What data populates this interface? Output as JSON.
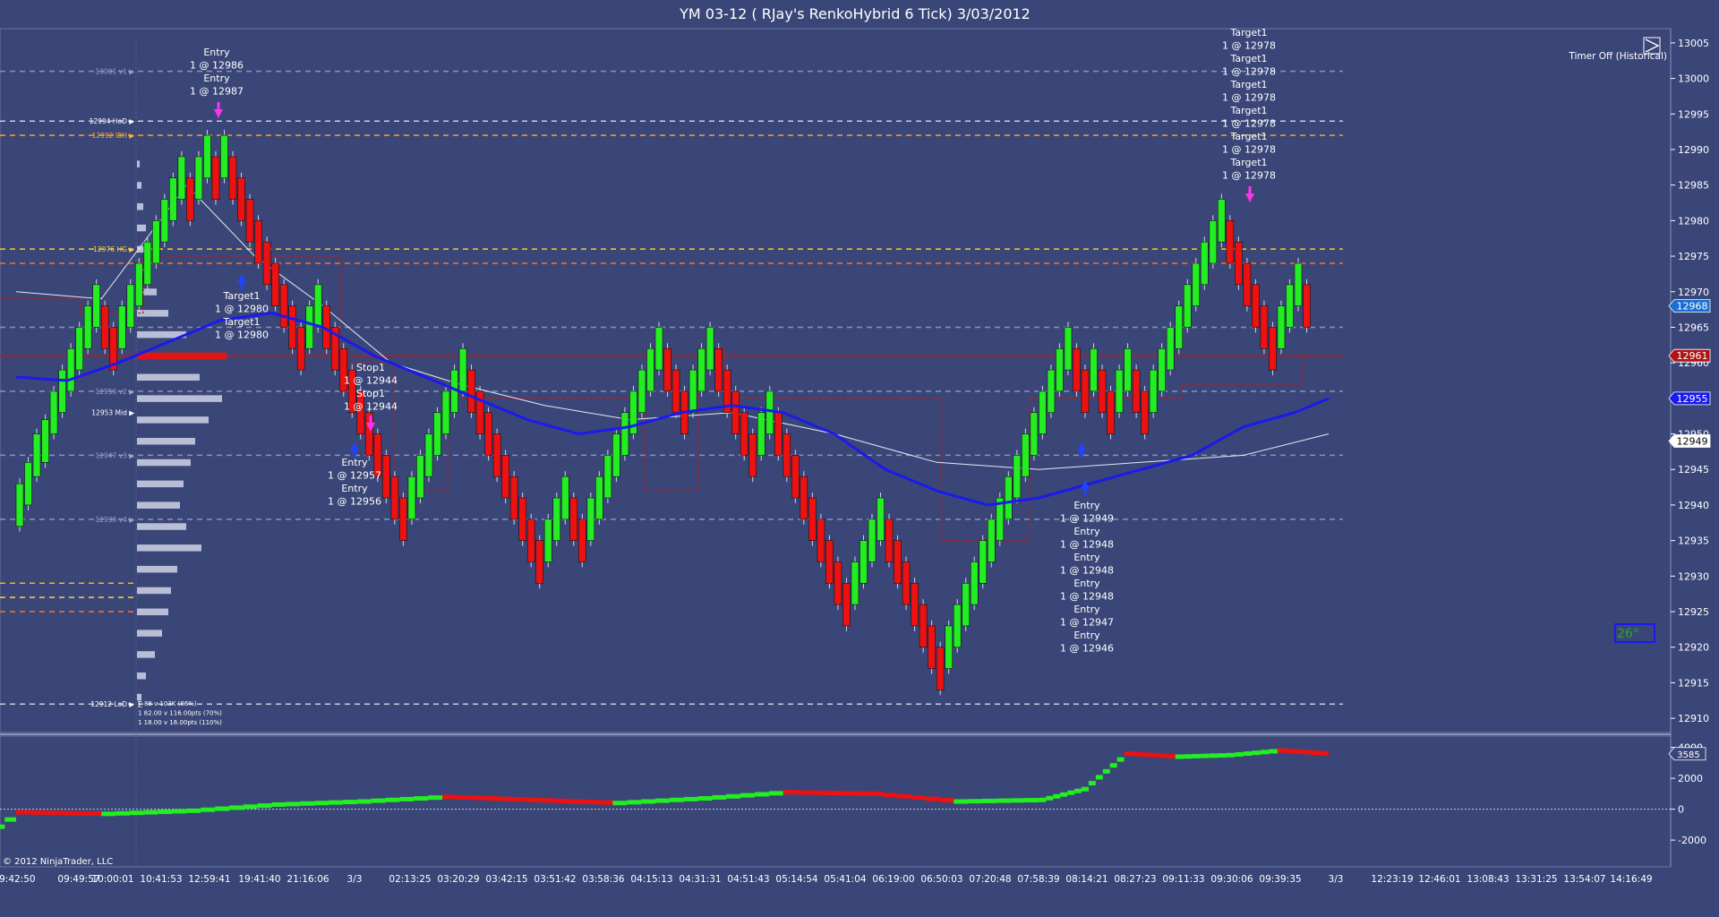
{
  "window": {
    "title": "YM 03-12 ( RJay's RenkoHybrid  6 Tick)  3/03/2012",
    "timer_label": "Timer Off (Historical)",
    "copyright": "© 2012 NinjaTrader, LLC",
    "temp_badge": "26°"
  },
  "colors": {
    "background": "#3a4677",
    "up_brick": "#22ee22",
    "down_brick": "#ee1111",
    "ma_line": "#1a1aee",
    "marker_entry": "#ff33ee",
    "marker_exit": "#2244ff"
  },
  "price_axis": {
    "min": 12908,
    "max": 13007,
    "ticks": [
      "13005",
      "13000",
      "12995",
      "12990",
      "12985",
      "12980",
      "12975",
      "12970",
      "12965",
      "12960",
      "12955",
      "12950",
      "12945",
      "12940",
      "12935",
      "12930",
      "12925",
      "12920",
      "12915",
      "12910"
    ],
    "badges": [
      {
        "label": "12968",
        "value": 12968,
        "bg": "#1a6fd0",
        "fg": "#ffffff"
      },
      {
        "label": "12961",
        "value": 12961,
        "bg": "#b01414",
        "fg": "#ffffff"
      },
      {
        "label": "12955",
        "value": 12955,
        "bg": "#1a1aee",
        "fg": "#ffffff"
      },
      {
        "label": "12949",
        "value": 12949,
        "bg": "#ffffff",
        "fg": "#000000"
      }
    ]
  },
  "level_labels": [
    {
      "label": "13001 v1 ▶",
      "value": 13001,
      "color": "#9aa3c8"
    },
    {
      "label": "12994 HoD ▶",
      "value": 12994,
      "color": "#ffffff"
    },
    {
      "label": "12992 IBH ▶",
      "value": 12992,
      "color": "#ffb020"
    },
    {
      "label": "12976 HG ▶",
      "value": 12976,
      "color": "#ffd040"
    },
    {
      "label": "12956 v2 ▶",
      "value": 12956,
      "color": "#9aa3c8"
    },
    {
      "label": "12953 Mid ▶",
      "value": 12953,
      "color": "#ffffff"
    },
    {
      "label": "12947 v3 ▶",
      "value": 12947,
      "color": "#9aa3c8"
    },
    {
      "label": "12938 v4 ▶",
      "value": 12938,
      "color": "#9aa3c8"
    },
    {
      "label": "12912 LoD ▶",
      "value": 12912,
      "color": "#ffffff"
    }
  ],
  "profile_stats": [
    "∑ 88 v 103K (86%)",
    "1 82.00 v 116.00pts (70%)",
    "1 18.00 v 16.00pts (110%)"
  ],
  "time_axis": {
    "labels": [
      "09:42:50",
      "09:49:57",
      "10:00:01",
      "10:41:53",
      "12:59:41",
      "19:41:40",
      "21:16:06",
      "3/3",
      "02:13:25",
      "03:20:29",
      "03:42:15",
      "03:51:42",
      "03:58:36",
      "04:15:13",
      "04:31:31",
      "04:51:43",
      "05:14:54",
      "05:41:04",
      "06:19:00",
      "06:50:03",
      "07:20:48",
      "07:58:39",
      "08:14:21",
      "08:27:23",
      "09:11:33",
      "09:30:06",
      "09:39:35",
      "3/3",
      "12:23:19",
      "12:46:01",
      "13:08:43",
      "13:31:25",
      "13:54:07",
      "14:16:49"
    ]
  },
  "trade_annotations": [
    {
      "lines": [
        "Entry",
        "1 @ 12986",
        "Entry",
        "1 @ 12987"
      ],
      "anchor": "trade_top_1"
    },
    {
      "lines": [
        "Target1",
        "1 @ 12980",
        "Target1",
        "1 @ 12980"
      ],
      "anchor": "trade_mid_1"
    },
    {
      "lines": [
        "Stop1",
        "1 @ 12944",
        "Stop1",
        "1 @ 12944"
      ],
      "anchor": "trade_mid_2"
    },
    {
      "lines": [
        "Entry",
        "1 @ 12957",
        "Entry",
        "1 @ 12956"
      ],
      "anchor": "trade_low_1"
    },
    {
      "lines": [
        "Entry",
        "1 @ 12949",
        "Entry",
        "1 @ 12948",
        "Entry",
        "1 @ 12948",
        "Entry",
        "1 @ 12948",
        "Entry",
        "1 @ 12947",
        "Entry",
        "1 @ 12946"
      ],
      "anchor": "trade_low_2"
    },
    {
      "lines": [
        "Target1",
        "1 @ 12978",
        "Target1",
        "1 @ 12978",
        "Target1",
        "1 @ 12978",
        "Target1",
        "1 @ 12978",
        "Target1",
        "1 @ 12978",
        "Target1",
        "1 @ 12978"
      ],
      "anchor": "trade_top_2"
    }
  ],
  "indicator_panel": {
    "ticks": [
      "4000",
      "2000",
      "0",
      "-2000"
    ],
    "range": [
      -3500,
      4500
    ],
    "badge": "3585"
  },
  "chart_data": {
    "type": "bar",
    "description_units": "price",
    "bricks": [
      {
        "o": 12937,
        "c": 12943
      },
      {
        "o": 12940,
        "c": 12946
      },
      {
        "o": 12944,
        "c": 12950
      },
      {
        "o": 12946,
        "c": 12952
      },
      {
        "o": 12950,
        "c": 12956
      },
      {
        "o": 12953,
        "c": 12959
      },
      {
        "o": 12956,
        "c": 12962
      },
      {
        "o": 12959,
        "c": 12965
      },
      {
        "o": 12962,
        "c": 12968
      },
      {
        "o": 12965,
        "c": 12971
      },
      {
        "o": 12968,
        "c": 12962
      },
      {
        "o": 12965,
        "c": 12959
      },
      {
        "o": 12962,
        "c": 12968
      },
      {
        "o": 12965,
        "c": 12971
      },
      {
        "o": 12968,
        "c": 12974
      },
      {
        "o": 12971,
        "c": 12977
      },
      {
        "o": 12974,
        "c": 12980
      },
      {
        "o": 12977,
        "c": 12983
      },
      {
        "o": 12980,
        "c": 12986
      },
      {
        "o": 12983,
        "c": 12989
      },
      {
        "o": 12986,
        "c": 12980
      },
      {
        "o": 12983,
        "c": 12989
      },
      {
        "o": 12986,
        "c": 12992
      },
      {
        "o": 12989,
        "c": 12983
      },
      {
        "o": 12986,
        "c": 12992
      },
      {
        "o": 12989,
        "c": 12983
      },
      {
        "o": 12986,
        "c": 12980
      },
      {
        "o": 12983,
        "c": 12977
      },
      {
        "o": 12980,
        "c": 12974
      },
      {
        "o": 12977,
        "c": 12971
      },
      {
        "o": 12974,
        "c": 12968
      },
      {
        "o": 12971,
        "c": 12965
      },
      {
        "o": 12968,
        "c": 12962
      },
      {
        "o": 12965,
        "c": 12959
      },
      {
        "o": 12962,
        "c": 12968
      },
      {
        "o": 12965,
        "c": 12971
      },
      {
        "o": 12968,
        "c": 12962
      },
      {
        "o": 12965,
        "c": 12959
      },
      {
        "o": 12962,
        "c": 12956
      },
      {
        "o": 12959,
        "c": 12953
      },
      {
        "o": 12956,
        "c": 12950
      },
      {
        "o": 12953,
        "c": 12947
      },
      {
        "o": 12950,
        "c": 12944
      },
      {
        "o": 12947,
        "c": 12941
      },
      {
        "o": 12944,
        "c": 12938
      },
      {
        "o": 12941,
        "c": 12935
      },
      {
        "o": 12938,
        "c": 12944
      },
      {
        "o": 12941,
        "c": 12947
      },
      {
        "o": 12944,
        "c": 12950
      },
      {
        "o": 12947,
        "c": 12953
      },
      {
        "o": 12950,
        "c": 12956
      },
      {
        "o": 12953,
        "c": 12959
      },
      {
        "o": 12956,
        "c": 12962
      },
      {
        "o": 12959,
        "c": 12953
      },
      {
        "o": 12956,
        "c": 12950
      },
      {
        "o": 12953,
        "c": 12947
      },
      {
        "o": 12950,
        "c": 12944
      },
      {
        "o": 12947,
        "c": 12941
      },
      {
        "o": 12944,
        "c": 12938
      },
      {
        "o": 12941,
        "c": 12935
      },
      {
        "o": 12938,
        "c": 12932
      },
      {
        "o": 12935,
        "c": 12929
      },
      {
        "o": 12932,
        "c": 12938
      },
      {
        "o": 12935,
        "c": 12941
      },
      {
        "o": 12938,
        "c": 12944
      },
      {
        "o": 12941,
        "c": 12935
      },
      {
        "o": 12938,
        "c": 12932
      },
      {
        "o": 12935,
        "c": 12941
      },
      {
        "o": 12938,
        "c": 12944
      },
      {
        "o": 12941,
        "c": 12947
      },
      {
        "o": 12944,
        "c": 12950
      },
      {
        "o": 12947,
        "c": 12953
      },
      {
        "o": 12950,
        "c": 12956
      },
      {
        "o": 12953,
        "c": 12959
      },
      {
        "o": 12956,
        "c": 12962
      },
      {
        "o": 12959,
        "c": 12965
      },
      {
        "o": 12962,
        "c": 12956
      },
      {
        "o": 12959,
        "c": 12953
      },
      {
        "o": 12956,
        "c": 12950
      },
      {
        "o": 12953,
        "c": 12959
      },
      {
        "o": 12956,
        "c": 12962
      },
      {
        "o": 12959,
        "c": 12965
      },
      {
        "o": 12962,
        "c": 12956
      },
      {
        "o": 12959,
        "c": 12953
      },
      {
        "o": 12956,
        "c": 12950
      },
      {
        "o": 12953,
        "c": 12947
      },
      {
        "o": 12950,
        "c": 12944
      },
      {
        "o": 12947,
        "c": 12953
      },
      {
        "o": 12950,
        "c": 12956
      },
      {
        "o": 12953,
        "c": 12947
      },
      {
        "o": 12950,
        "c": 12944
      },
      {
        "o": 12947,
        "c": 12941
      },
      {
        "o": 12944,
        "c": 12938
      },
      {
        "o": 12941,
        "c": 12935
      },
      {
        "o": 12938,
        "c": 12932
      },
      {
        "o": 12935,
        "c": 12929
      },
      {
        "o": 12932,
        "c": 12926
      },
      {
        "o": 12929,
        "c": 12923
      },
      {
        "o": 12926,
        "c": 12932
      },
      {
        "o": 12929,
        "c": 12935
      },
      {
        "o": 12932,
        "c": 12938
      },
      {
        "o": 12935,
        "c": 12941
      },
      {
        "o": 12938,
        "c": 12932
      },
      {
        "o": 12935,
        "c": 12929
      },
      {
        "o": 12932,
        "c": 12926
      },
      {
        "o": 12929,
        "c": 12923
      },
      {
        "o": 12926,
        "c": 12920
      },
      {
        "o": 12923,
        "c": 12917
      },
      {
        "o": 12920,
        "c": 12914
      },
      {
        "o": 12917,
        "c": 12923
      },
      {
        "o": 12920,
        "c": 12926
      },
      {
        "o": 12923,
        "c": 12929
      },
      {
        "o": 12926,
        "c": 12932
      },
      {
        "o": 12929,
        "c": 12935
      },
      {
        "o": 12932,
        "c": 12938
      },
      {
        "o": 12935,
        "c": 12941
      },
      {
        "o": 12938,
        "c": 12944
      },
      {
        "o": 12941,
        "c": 12947
      },
      {
        "o": 12944,
        "c": 12950
      },
      {
        "o": 12947,
        "c": 12953
      },
      {
        "o": 12950,
        "c": 12956
      },
      {
        "o": 12953,
        "c": 12959
      },
      {
        "o": 12956,
        "c": 12962
      },
      {
        "o": 12959,
        "c": 12965
      },
      {
        "o": 12962,
        "c": 12956
      },
      {
        "o": 12959,
        "c": 12953
      },
      {
        "o": 12956,
        "c": 12962
      },
      {
        "o": 12959,
        "c": 12953
      },
      {
        "o": 12956,
        "c": 12950
      },
      {
        "o": 12953,
        "c": 12959
      },
      {
        "o": 12956,
        "c": 12962
      },
      {
        "o": 12959,
        "c": 12953
      },
      {
        "o": 12956,
        "c": 12950
      },
      {
        "o": 12953,
        "c": 12959
      },
      {
        "o": 12956,
        "c": 12962
      },
      {
        "o": 12959,
        "c": 12965
      },
      {
        "o": 12962,
        "c": 12968
      },
      {
        "o": 12965,
        "c": 12971
      },
      {
        "o": 12968,
        "c": 12974
      },
      {
        "o": 12971,
        "c": 12977
      },
      {
        "o": 12974,
        "c": 12980
      },
      {
        "o": 12977,
        "c": 12983
      },
      {
        "o": 12980,
        "c": 12974
      },
      {
        "o": 12977,
        "c": 12971
      },
      {
        "o": 12974,
        "c": 12968
      },
      {
        "o": 12971,
        "c": 12965
      },
      {
        "o": 12968,
        "c": 12962
      },
      {
        "o": 12965,
        "c": 12959
      },
      {
        "o": 12962,
        "c": 12968
      },
      {
        "o": 12965,
        "c": 12971
      },
      {
        "o": 12968,
        "c": 12974
      },
      {
        "o": 12971,
        "c": 12965
      }
    ],
    "moving_average": [
      {
        "i": 0,
        "v": 12958
      },
      {
        "i": 6,
        "v": 12957.5
      },
      {
        "i": 12,
        "v": 12960
      },
      {
        "i": 18,
        "v": 12963
      },
      {
        "i": 24,
        "v": 12966
      },
      {
        "i": 30,
        "v": 12967
      },
      {
        "i": 36,
        "v": 12965
      },
      {
        "i": 42,
        "v": 12961
      },
      {
        "i": 48,
        "v": 12958
      },
      {
        "i": 54,
        "v": 12955
      },
      {
        "i": 60,
        "v": 12952
      },
      {
        "i": 66,
        "v": 12950
      },
      {
        "i": 72,
        "v": 12951
      },
      {
        "i": 78,
        "v": 12953
      },
      {
        "i": 84,
        "v": 12954
      },
      {
        "i": 90,
        "v": 12953
      },
      {
        "i": 96,
        "v": 12950
      },
      {
        "i": 102,
        "v": 12945
      },
      {
        "i": 108,
        "v": 12942
      },
      {
        "i": 114,
        "v": 12940
      },
      {
        "i": 120,
        "v": 12941
      },
      {
        "i": 126,
        "v": 12943
      },
      {
        "i": 132,
        "v": 12945
      },
      {
        "i": 138,
        "v": 12947
      },
      {
        "i": 144,
        "v": 12951
      },
      {
        "i": 150,
        "v": 12953
      },
      {
        "i": 154,
        "v": 12955
      }
    ],
    "vwap_line": [
      {
        "i": 0,
        "v": 12970
      },
      {
        "i": 10,
        "v": 12969
      },
      {
        "i": 20,
        "v": 12985
      },
      {
        "i": 28,
        "v": 12975
      },
      {
        "i": 36,
        "v": 12968
      },
      {
        "i": 44,
        "v": 12960
      },
      {
        "i": 52,
        "v": 12957
      },
      {
        "i": 62,
        "v": 12954
      },
      {
        "i": 72,
        "v": 12952
      },
      {
        "i": 84,
        "v": 12953
      },
      {
        "i": 96,
        "v": 12950
      },
      {
        "i": 108,
        "v": 12946
      },
      {
        "i": 120,
        "v": 12945
      },
      {
        "i": 132,
        "v": 12946
      },
      {
        "i": 144,
        "v": 12947
      },
      {
        "i": 154,
        "v": 12950
      }
    ],
    "horizontal_levels": [
      {
        "value": 13001,
        "color": "#8a93b8",
        "dash": "6,5"
      },
      {
        "value": 12994,
        "color": "#c8cce0",
        "dash": "6,5"
      },
      {
        "value": 12992,
        "color": "#ffa020",
        "dash": "6,5"
      },
      {
        "value": 12976,
        "color": "#ffc830",
        "dash": "6,5"
      },
      {
        "value": 12974,
        "color": "#ff7020",
        "dash": "6,5"
      },
      {
        "value": 12965,
        "color": "#8a93b8",
        "dash": "6,5"
      },
      {
        "value": 12961,
        "color": "#c01818",
        "dash": ""
      },
      {
        "value": 12956,
        "color": "#8a93b8",
        "dash": "6,5"
      },
      {
        "value": 12947,
        "color": "#8a93b8",
        "dash": "6,5"
      },
      {
        "value": 12938,
        "color": "#8a93b8",
        "dash": "6,5"
      },
      {
        "value": 12912,
        "color": "#c8cce0",
        "dash": "6,5"
      }
    ],
    "volume_profile": [
      {
        "price": 12988,
        "w": 3
      },
      {
        "price": 12985,
        "w": 5
      },
      {
        "price": 12982,
        "w": 7
      },
      {
        "price": 12979,
        "w": 10
      },
      {
        "price": 12976,
        "w": 12
      },
      {
        "price": 12973,
        "w": 16
      },
      {
        "price": 12970,
        "w": 22
      },
      {
        "price": 12967,
        "w": 35
      },
      {
        "price": 12964,
        "w": 55
      },
      {
        "price": 12961,
        "w": 100
      },
      {
        "price": 12958,
        "w": 70
      },
      {
        "price": 12955,
        "w": 95
      },
      {
        "price": 12952,
        "w": 80
      },
      {
        "price": 12949,
        "w": 65
      },
      {
        "price": 12946,
        "w": 60
      },
      {
        "price": 12943,
        "w": 52
      },
      {
        "price": 12940,
        "w": 48
      },
      {
        "price": 12937,
        "w": 55
      },
      {
        "price": 12934,
        "w": 72
      },
      {
        "price": 12931,
        "w": 45
      },
      {
        "price": 12928,
        "w": 38
      },
      {
        "price": 12925,
        "w": 35
      },
      {
        "price": 12922,
        "w": 28
      },
      {
        "price": 12919,
        "w": 20
      },
      {
        "price": 12916,
        "w": 10
      },
      {
        "price": 12913,
        "w": 5
      }
    ],
    "indicator_series": [
      {
        "i": -8,
        "v": -3000
      },
      {
        "i": 0,
        "v": -200
      },
      {
        "i": 10,
        "v": -300
      },
      {
        "i": 20,
        "v": -100
      },
      {
        "i": 30,
        "v": 300
      },
      {
        "i": 40,
        "v": 500
      },
      {
        "i": 50,
        "v": 800
      },
      {
        "i": 60,
        "v": 600
      },
      {
        "i": 70,
        "v": 400
      },
      {
        "i": 80,
        "v": 700
      },
      {
        "i": 90,
        "v": 1100
      },
      {
        "i": 100,
        "v": 1000
      },
      {
        "i": 110,
        "v": 500
      },
      {
        "i": 120,
        "v": 600
      },
      {
        "i": 125,
        "v": 1300
      },
      {
        "i": 130,
        "v": 3600
      },
      {
        "i": 136,
        "v": 3400
      },
      {
        "i": 142,
        "v": 3500
      },
      {
        "i": 148,
        "v": 3800
      },
      {
        "i": 154,
        "v": 3585
      }
    ],
    "ylim": [
      12908,
      13007
    ]
  }
}
